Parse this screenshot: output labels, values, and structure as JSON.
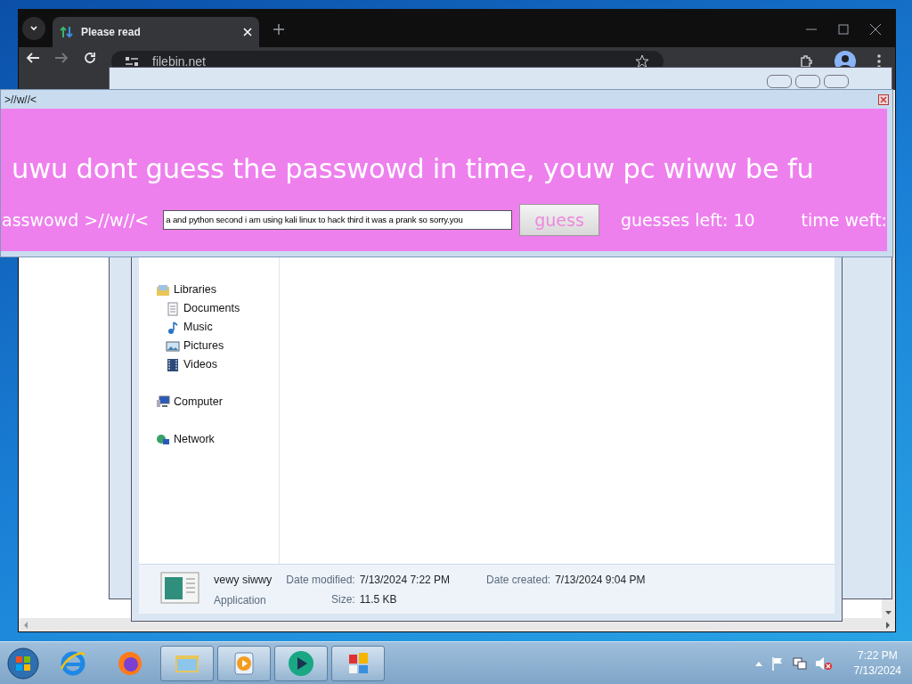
{
  "browser": {
    "tab_title": "Please read",
    "address": "filebin.net"
  },
  "explorer": {
    "nav": [
      {
        "label": "Libraries",
        "kind": "libraries",
        "children": [
          {
            "label": "Documents",
            "kind": "document"
          },
          {
            "label": "Music",
            "kind": "music"
          },
          {
            "label": "Pictures",
            "kind": "pictures"
          },
          {
            "label": "Videos",
            "kind": "videos"
          }
        ]
      },
      {
        "label": "Computer",
        "kind": "computer"
      },
      {
        "label": "Network",
        "kind": "network"
      }
    ],
    "details": {
      "name": "vewy siwwy",
      "type": "Application",
      "fields": [
        {
          "label": "Date modified:",
          "value": "7/13/2024 7:22 PM"
        },
        {
          "label": "Date created:",
          "value": "7/13/2024 9:04 PM"
        },
        {
          "label": "Size:",
          "value": "11.5 KB"
        }
      ]
    }
  },
  "prank_window": {
    "title": ">//w//<",
    "headline": "uwu dont guess the passwowd in time, youw pc wiww be fu",
    "prompt": "asswowd >//w//<",
    "input_value": "a and python second i am using kali linux to hack third it was a prank so sorry.you",
    "button": "guess",
    "guesses_left": "guesses left: 10",
    "timer": "time weft:"
  },
  "taskbar": {
    "apps": [
      {
        "kind": "ie",
        "open": false
      },
      {
        "kind": "firefox",
        "open": false
      },
      {
        "kind": "folder",
        "open": true
      },
      {
        "kind": "media",
        "open": true
      },
      {
        "kind": "disc",
        "open": true
      },
      {
        "kind": "tiles",
        "open": true
      }
    ],
    "time": "7:22 PM",
    "date": "7/13/2024"
  }
}
